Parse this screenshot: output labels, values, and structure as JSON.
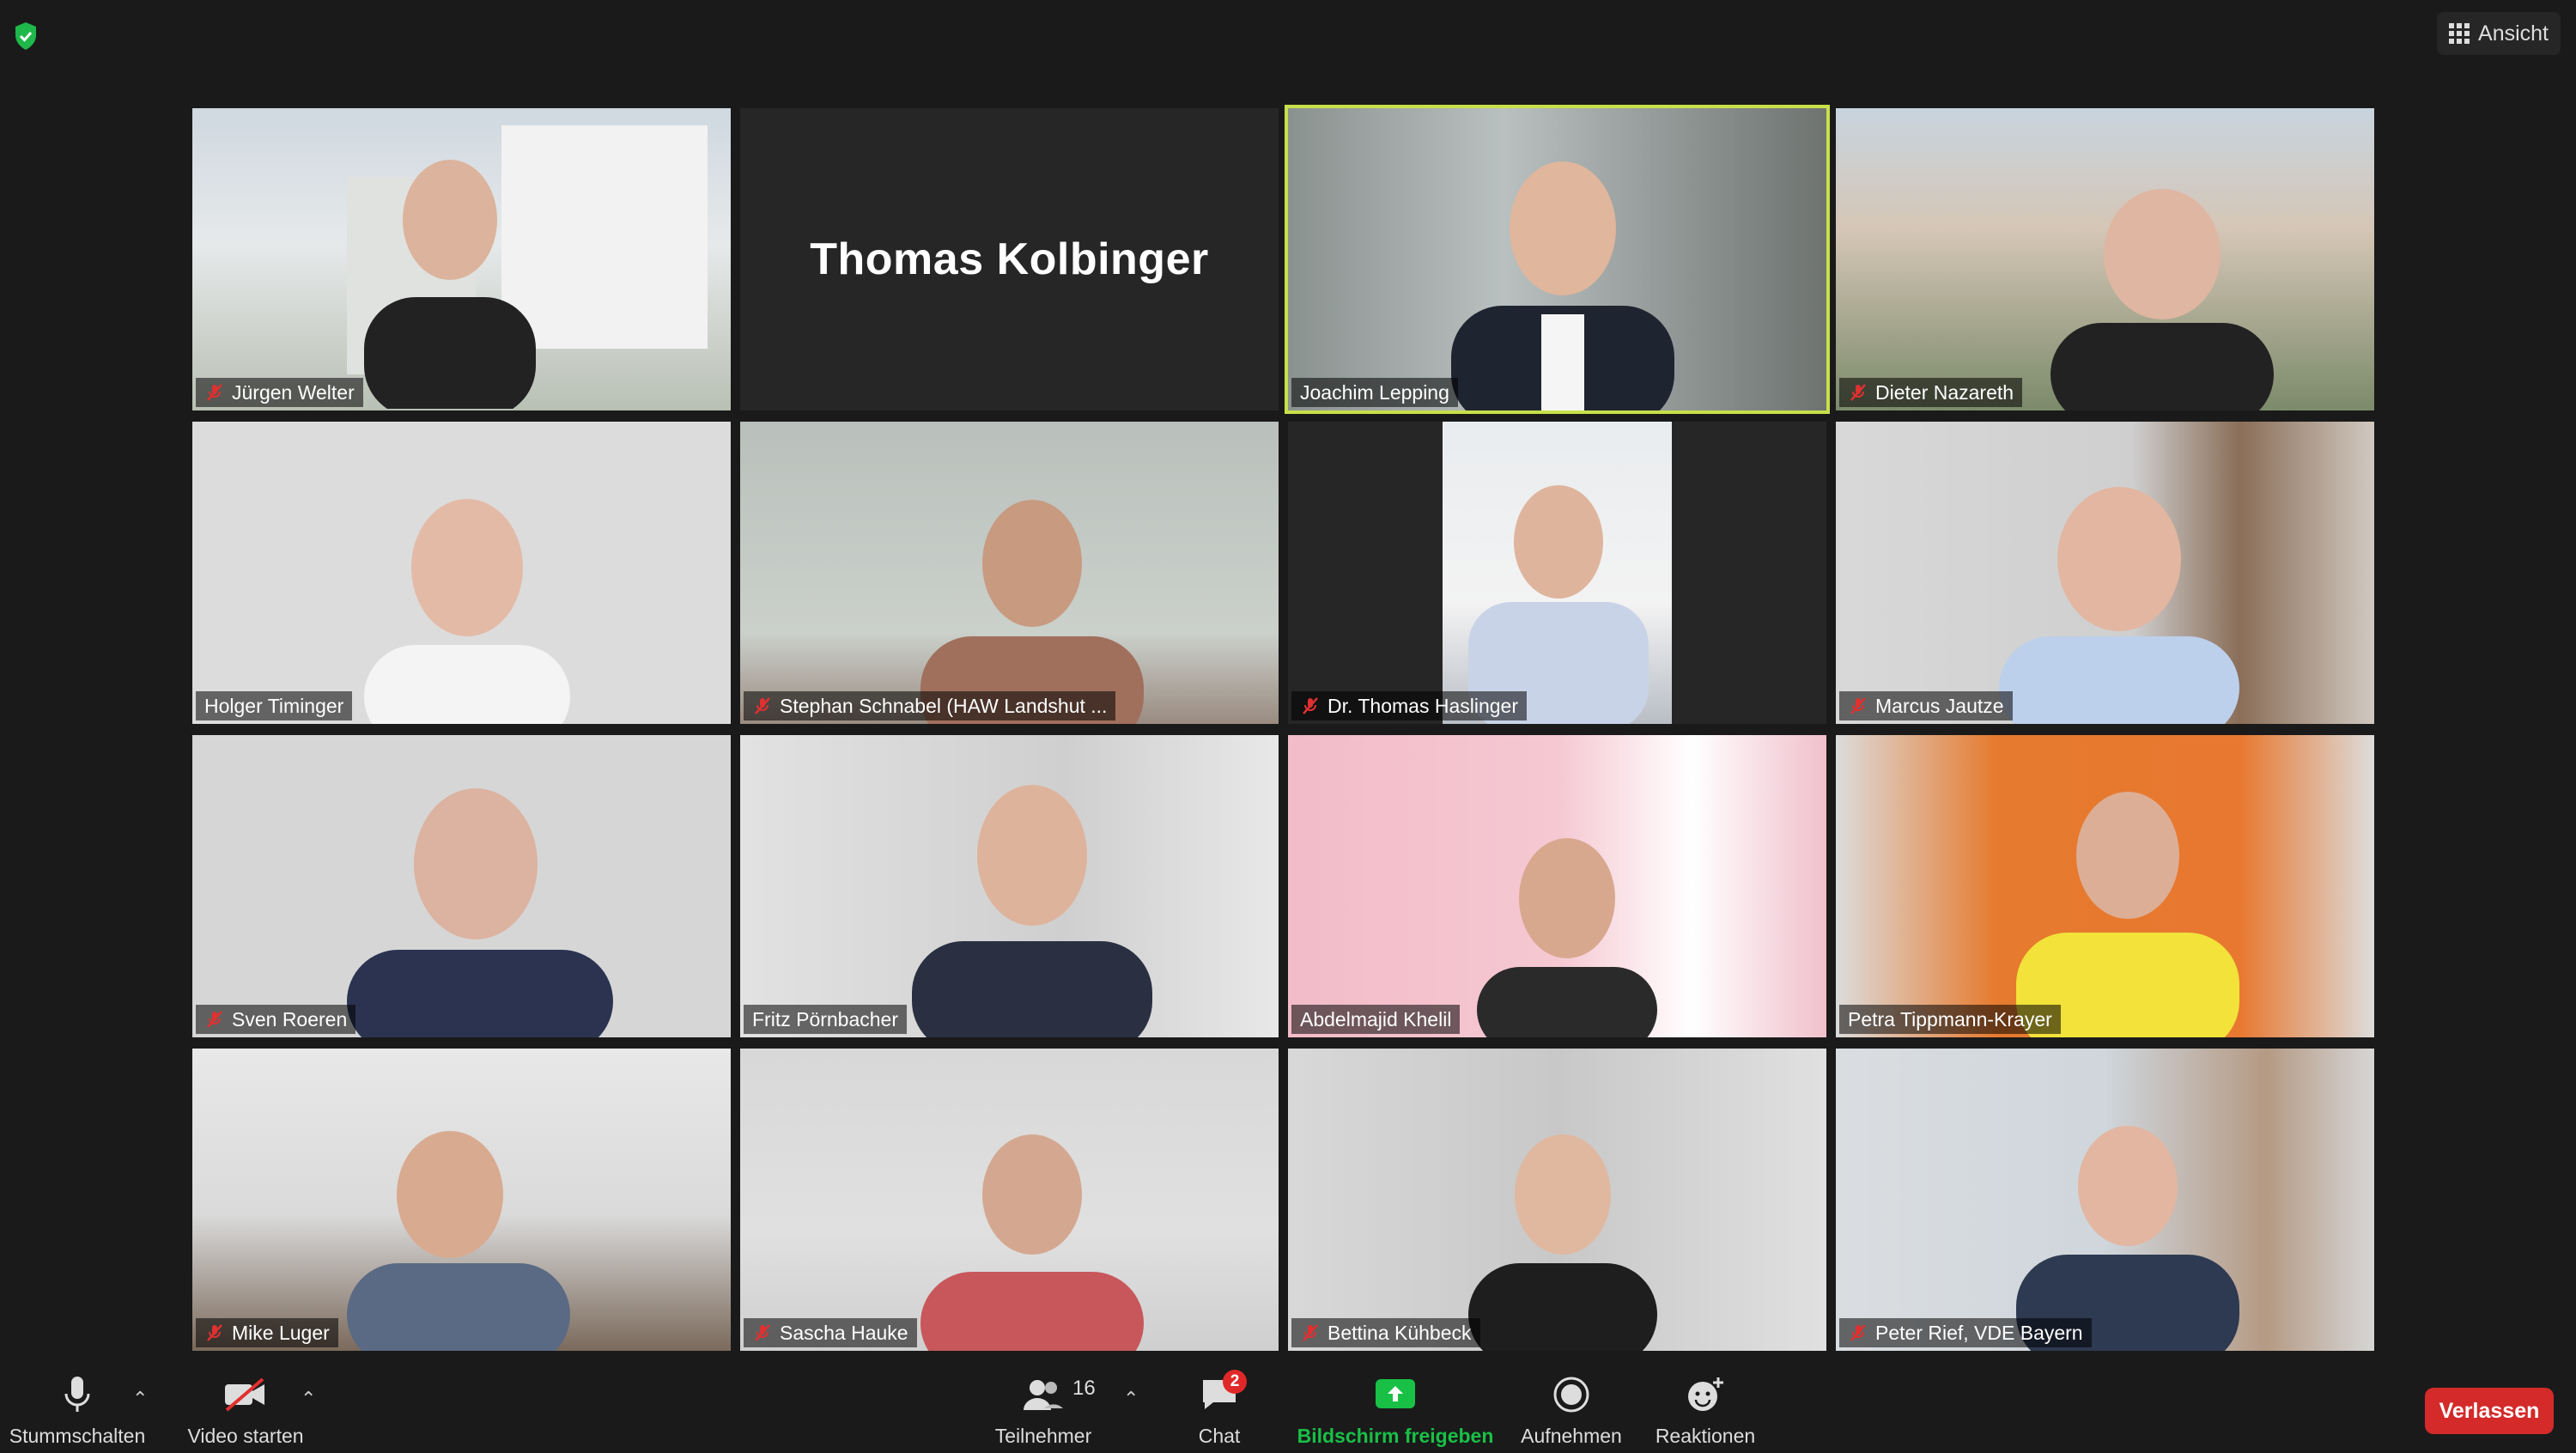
{
  "app": {
    "view_label": "Ansicht"
  },
  "tiles": [
    {
      "name": "Jürgen Welter",
      "muted": true
    },
    {
      "name": "Thomas Kolbinger",
      "muted": false,
      "no_video": true
    },
    {
      "name": "Joachim Lepping",
      "muted": false,
      "active": true
    },
    {
      "name": "Dieter Nazareth",
      "muted": true
    },
    {
      "name": "Holger Timinger",
      "muted": false
    },
    {
      "name": "Stephan Schnabel (HAW Landshut ...",
      "muted": true
    },
    {
      "name": "Dr. Thomas Haslinger",
      "muted": true
    },
    {
      "name": "Marcus Jautze",
      "muted": true
    },
    {
      "name": "Sven Roeren",
      "muted": true
    },
    {
      "name": "Fritz Pörnbacher",
      "muted": false
    },
    {
      "name": "Abdelmajid Khelil",
      "muted": false
    },
    {
      "name": "Petra Tippmann-Krayer",
      "muted": false
    },
    {
      "name": "Mike Luger",
      "muted": true
    },
    {
      "name": "Sascha Hauke",
      "muted": true
    },
    {
      "name": "Bettina Kühbeck",
      "muted": true
    },
    {
      "name": "Peter Rief, VDE Bayern",
      "muted": true
    }
  ],
  "toolbar": {
    "mute_label": "Stummschalten",
    "video_label": "Video starten",
    "participants_label": "Teilnehmer",
    "participants_count": "16",
    "chat_label": "Chat",
    "chat_badge": "2",
    "share_label": "Bildschirm freigeben",
    "record_label": "Aufnehmen",
    "reactions_label": "Reaktionen",
    "leave_label": "Verlassen",
    "caret": "⌃"
  },
  "colors": {
    "active_speaker": "#c8e04a",
    "share_green": "#19c046",
    "leave_red": "#d42a2a",
    "mute_red": "#e03030"
  }
}
